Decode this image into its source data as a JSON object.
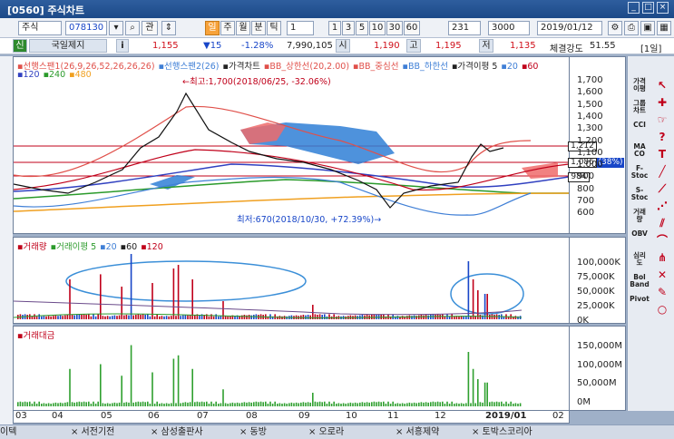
{
  "window": {
    "title": "[0560] 주식차트",
    "badge": "1 ?"
  },
  "toolbar": {
    "market": "주식",
    "code": "078130",
    "search_label": "관",
    "period_label": "일",
    "periods": [
      "주",
      "월",
      "분",
      "틱"
    ],
    "interval_value": "1",
    "interval_options": [
      "1",
      "3",
      "5",
      "10",
      "30",
      "60"
    ],
    "count_value": "231",
    "max_value": "3000",
    "date_value": "2019/01/12"
  },
  "quote": {
    "name": "국일제지",
    "info_label": "i",
    "price": "1,155",
    "change": "▼15",
    "change_pct": "-1.28%",
    "volume": "7,990,105",
    "open_label": "시",
    "open": "1,190",
    "high_label": "고",
    "high": "1,195",
    "low_label": "저",
    "low": "1,135",
    "strength_label": "체결강도",
    "strength": "51.55",
    "period_tag": "[1일]"
  },
  "price_pane": {
    "legend_row1": [
      {
        "text": "선행스팬1(26,9,26,52,26,26,26)",
        "color": "#e0504a"
      },
      {
        "text": "선행스팬2(26)",
        "color": "#3f7fd6"
      },
      {
        "text": "가격차트",
        "color": "#222222"
      },
      {
        "text": "BB_상한선(20,2.00)",
        "color": "#e0504a"
      },
      {
        "text": "BB_중심선",
        "color": "#e0504a"
      },
      {
        "text": "BB_하한선",
        "color": "#3f7fd6"
      },
      {
        "text": "가격이평 5",
        "color": "#222222"
      },
      {
        "text": "20",
        "color": "#3f7fd6"
      },
      {
        "text": "60",
        "color": "#c0001a"
      }
    ],
    "legend_row2": [
      {
        "text": "120",
        "color": "#3040c0"
      },
      {
        "text": "240",
        "color": "#2a9a2a"
      },
      {
        "text": "480",
        "color": "#f0a020"
      }
    ],
    "max_annot": "←최고:1,700(2018/06/25, -32.06%)",
    "min_annot": "최저:670(2018/10/30, +72.39%)→",
    "y_ticks": [
      "1,700",
      "1,600",
      "1,500",
      "1,400",
      "1,300",
      "1,200",
      "1,100",
      "1,000",
      "900",
      "800",
      "700",
      "600"
    ],
    "price_tags": [
      "1,212",
      "1,086",
      "984"
    ],
    "tag_colors": [
      "#ffffff",
      "#ffffff",
      "#ffffff"
    ],
    "blue_tag": "(38%)"
  },
  "volume_pane": {
    "legend": [
      {
        "text": "거래량",
        "color": "#c0001a"
      },
      {
        "text": "거래이평 5",
        "color": "#2a9a2a"
      },
      {
        "text": "20",
        "color": "#3f7fd6"
      },
      {
        "text": "60",
        "color": "#222222"
      },
      {
        "text": "120",
        "color": "#c0001a"
      }
    ],
    "y_ticks": [
      "100,000K",
      "75,000K",
      "50,000K",
      "25,000K",
      "0K"
    ]
  },
  "amount_pane": {
    "legend": [
      {
        "text": "거래대금",
        "color": "#c0001a"
      }
    ],
    "y_ticks": [
      "150,000M",
      "100,000M",
      "50,000M",
      "0M"
    ]
  },
  "xaxis": {
    "labels": [
      "03",
      "04",
      "05",
      "06",
      "07",
      "08",
      "09",
      "10",
      "11",
      "12",
      "2019/01",
      "02"
    ]
  },
  "right_panel": {
    "tools": [
      "가격\n이평",
      "그룹\n차트",
      "CCI",
      "MA\nCO",
      "F-\nStoc",
      "S-\nStoc",
      "거래\n량",
      "OBV",
      "심리\n도",
      "Bol\nBand",
      "Pivot"
    ]
  },
  "tabs": [
    "이텍",
    "서전기전",
    "삼성출판사",
    "동방",
    "오로라",
    "서흥제약",
    "토박스코리아"
  ],
  "colors": {
    "accent": "#f7a23a",
    "down": "#1846c8",
    "up": "#d0101a",
    "title_bg": "#1c4a88"
  }
}
